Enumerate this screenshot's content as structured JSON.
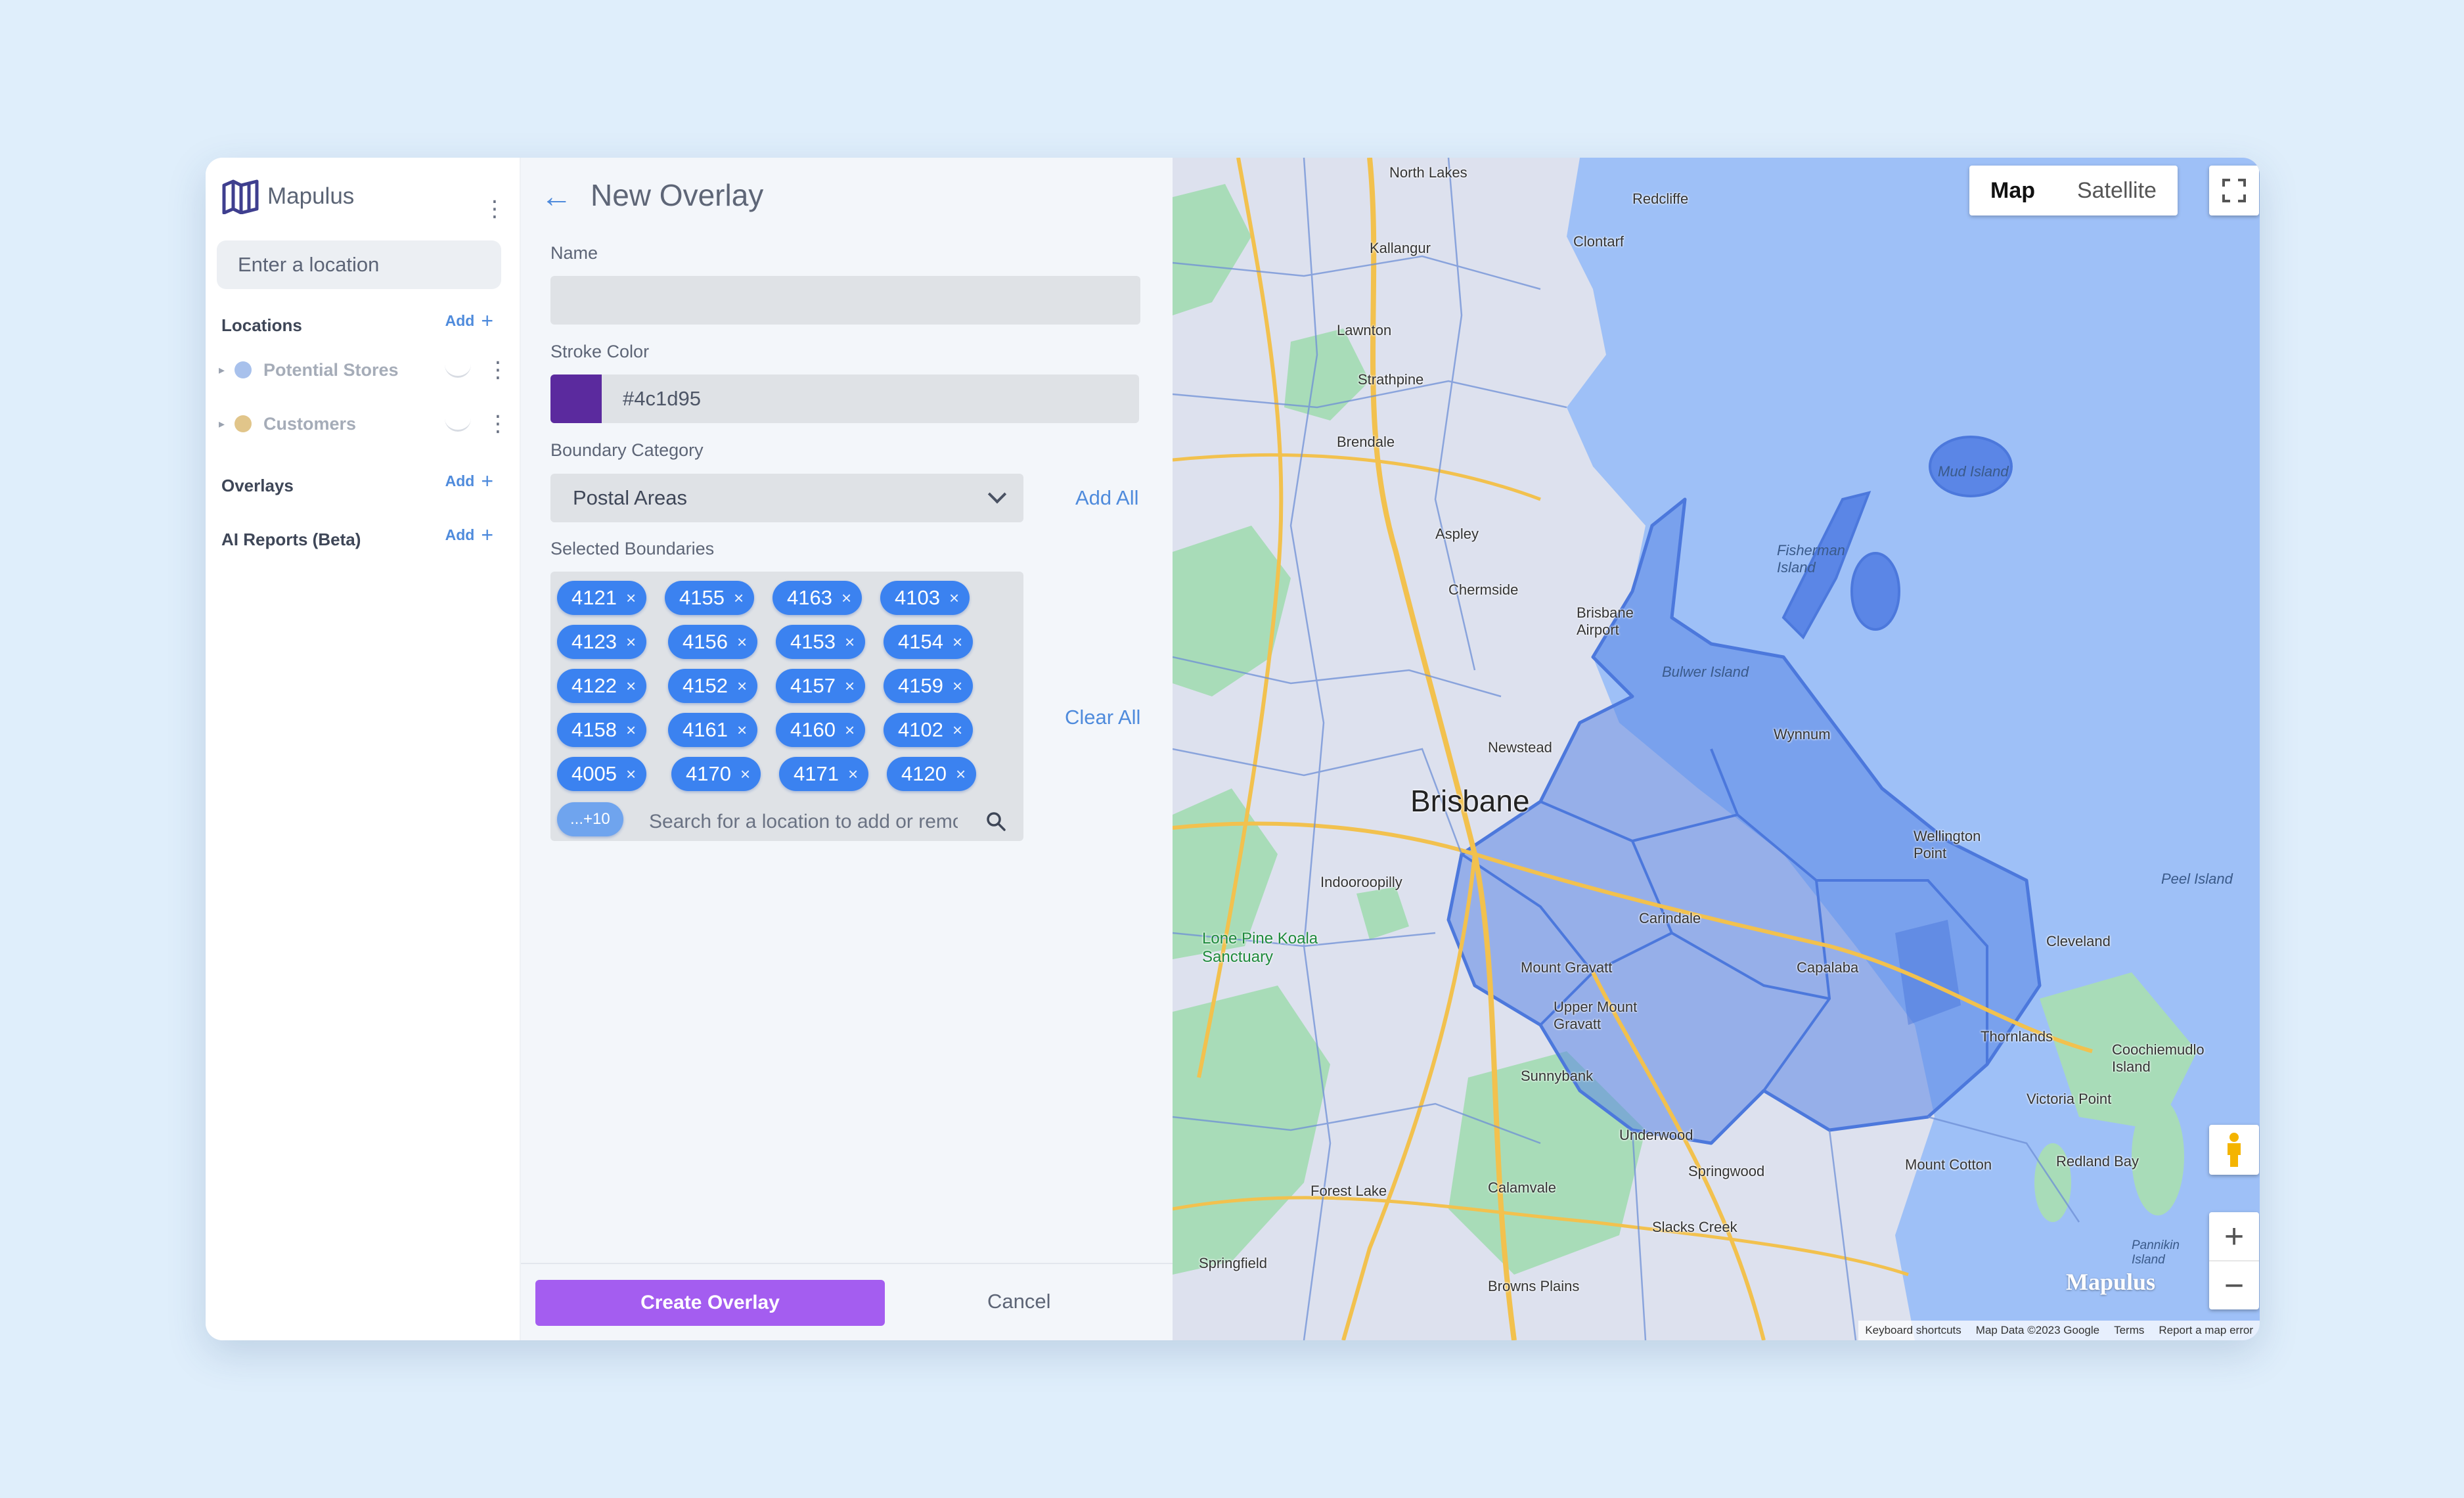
{
  "app": {
    "name": "Mapulus"
  },
  "sidebar": {
    "search_placeholder": "Enter a location",
    "sections": {
      "locations": {
        "title": "Locations",
        "add_label": "Add"
      },
      "overlays": {
        "title": "Overlays",
        "add_label": "Add"
      },
      "ai_reports": {
        "title": "AI Reports (Beta)",
        "add_label": "Add"
      }
    },
    "location_items": [
      {
        "label": "Potential Stores",
        "color": "#a8c1ec"
      },
      {
        "label": "Customers",
        "color": "#e1c58a"
      }
    ]
  },
  "overlay_form": {
    "title": "New Overlay",
    "name_label": "Name",
    "name_value": "",
    "stroke_label": "Stroke Color",
    "stroke_color": "#4c1d95",
    "stroke_display_color": "#5b2a9e",
    "boundary_category_label": "Boundary Category",
    "boundary_category_value": "Postal Areas",
    "add_all_label": "Add All",
    "selected_boundaries_label": "Selected Boundaries",
    "clear_all_label": "Clear All",
    "chips": [
      "4121",
      "4155",
      "4163",
      "4103",
      "4123",
      "4156",
      "4153",
      "4154",
      "4122",
      "4152",
      "4157",
      "4159",
      "4158",
      "4161",
      "4160",
      "4102",
      "4005",
      "4170",
      "4171",
      "4120"
    ],
    "more_label": "...+10",
    "boundary_search_placeholder": "Search for a location to add or remove",
    "create_label": "Create Overlay",
    "cancel_label": "Cancel"
  },
  "map": {
    "toggle": [
      "Map",
      "Satellite"
    ],
    "active_view": "Map",
    "labels": {
      "north_lakes": "North Lakes",
      "redcliffe": "Redcliffe",
      "clontarf": "Clontarf",
      "kallangur": "Kallangur",
      "lawnton": "Lawnton",
      "strathpine": "Strathpine",
      "brendale": "Brendale",
      "aspley": "Aspley",
      "chermside": "Chermside",
      "brisbane_airport": "Brisbane Airport",
      "mud_island": "Mud Island",
      "fisherman_island": "Fisherman Island",
      "bulwer_island": "Bulwer Island",
      "wynnum": "Wynnum",
      "newstead": "Newstead",
      "brisbane": "Brisbane",
      "wellington_point": "Wellington Point",
      "peel_island": "Peel Island",
      "indooroopilly": "Indooroopilly",
      "carindale": "Carindale",
      "lone_pine": "Lone Pine Koala Sanctuary",
      "mount_gravatt": "Mount Gravatt",
      "capalaba": "Capalaba",
      "cleveland": "Cleveland",
      "upper_mount_gravatt": "Upper Mount Gravatt",
      "thornlands": "Thornlands",
      "coochiemudlo": "Coochiemudlo Island",
      "sunnybank": "Sunnybank",
      "victoria_point": "Victoria Point",
      "underwood": "Underwood",
      "springwood": "Springwood",
      "mount_cotton": "Mount Cotton",
      "redland_bay": "Redland Bay",
      "forest_lake": "Forest Lake",
      "calamvale": "Calamvale",
      "slacks_creek": "Slacks Creek",
      "springfield": "Springfield",
      "browns_plains": "Browns Plains",
      "pannikin_island": "Pannikin Island"
    },
    "watermark": "Mapulus",
    "credits": [
      "Keyboard shortcuts",
      "Map Data ©2023 Google",
      "Terms",
      "Report a map error"
    ],
    "colors": {
      "land": "#dde1ee",
      "water": "#9ec0f7",
      "park": "#a8dcb8",
      "overlay": "#5b86e6",
      "road": "#f2c14e"
    }
  }
}
